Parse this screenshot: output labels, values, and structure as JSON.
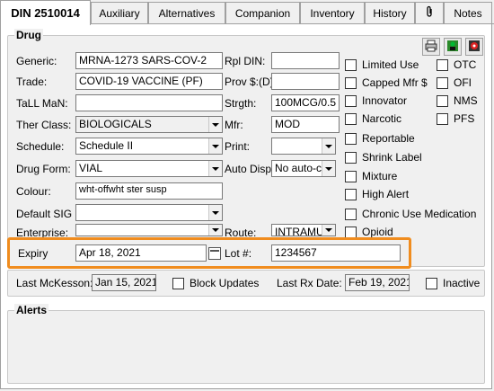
{
  "tabs": {
    "din": "DIN 2510014",
    "auxiliary": "Auxiliary",
    "alternatives": "Alternatives",
    "companion": "Companion",
    "inventory": "Inventory",
    "history": "History",
    "attach_glyph": "0",
    "notes": "Notes"
  },
  "drug": {
    "title": "Drug",
    "generic_label": "Generic:",
    "generic_value": "MRNA-1273 SARS-COV-2",
    "trade_label": "Trade:",
    "trade_value": "COVID-19 VACCINE (PF)",
    "tall_label": "TaLL MaN:",
    "tall_value": "",
    "therclass_label": "Ther Class:",
    "therclass_value": "BIOLOGICALS",
    "schedule_label": "Schedule:",
    "schedule_value": "Schedule II",
    "drugform_label": "Drug Form:",
    "drugform_value": "VIAL",
    "colour_label": "Colour:",
    "colour_value": "wht-offwht ster susp",
    "sig_label": "Default SIG",
    "sig_value": "",
    "enterprise_label": "Enterprise:",
    "enterprise_value": "",
    "rpldin_label": "Rpl DIN:",
    "rpldin_value": "",
    "prov_label": "Prov $:(D)",
    "prov_value": "",
    "strgth_label": "Strgth:",
    "strgth_value": "100MCG/0.5",
    "mfr_label": "Mfr:",
    "mfr_value": "MOD",
    "print_label": "Print:",
    "print_value": "",
    "autodisp_label": "Auto Disp:",
    "autodisp_value": "No auto-c",
    "route_label": "Route:",
    "route_value": "INTRAMU",
    "expiry_label": "Expiry",
    "expiry_value": "Apr 18, 2021",
    "lot_label": "Lot #:",
    "lot_value": "1234567"
  },
  "flags": {
    "limited_use": "Limited Use",
    "capped_mfr": "Capped Mfr $",
    "innovator": "Innovator",
    "narcotic": "Narcotic",
    "reportable": "Reportable",
    "shrink_label": "Shrink Label",
    "mixture": "Mixture",
    "high_alert": "High Alert",
    "chronic_use": "Chronic Use Medication",
    "opioid": "Opioid",
    "otc": "OTC",
    "ofi": "OFI",
    "nms": "NMS",
    "pfs": "PFS"
  },
  "bottom": {
    "last_mckesson_label": "Last McKesson:",
    "last_mckesson_value": "Jan 15, 2021",
    "block_updates": "Block Updates",
    "last_rx_label": "Last Rx Date:",
    "last_rx_value": "Feb 19, 2021",
    "inactive": "Inactive"
  },
  "alerts": {
    "title": "Alerts"
  },
  "colors": {
    "highlight": "#f08c1e"
  },
  "icons": [
    "print-icon",
    "green-figure-icon",
    "red-circle-icon",
    "paperclip-icon",
    "calendar-icon",
    "dropdown-arrow-icon"
  ]
}
